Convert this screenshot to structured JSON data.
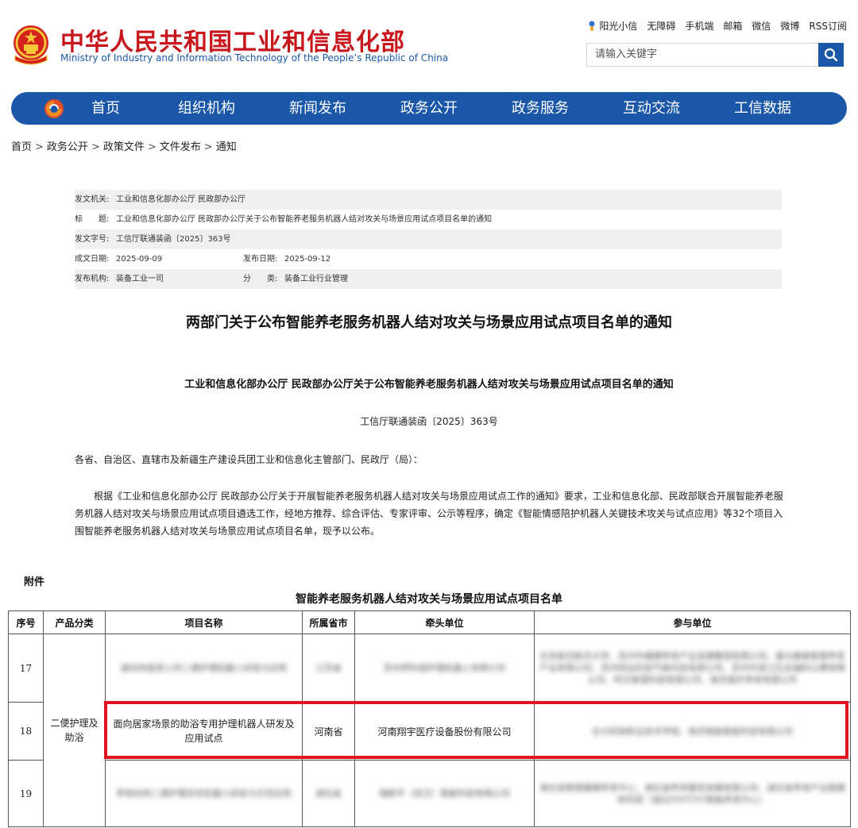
{
  "header": {
    "site_title": "中华人民共和国工业和信息化部",
    "site_subtitle": "Ministry of Industry and Information Technology of the People’s Republic of China",
    "top_links": [
      "阳光小信",
      "无障碍",
      "手机端",
      "邮箱",
      "微信",
      "微博",
      "RSS订阅"
    ],
    "search_placeholder": "请输入关键字"
  },
  "nav": {
    "items": [
      "首页",
      "组织机构",
      "新闻发布",
      "政务公开",
      "政务服务",
      "互动交流",
      "工信数据"
    ]
  },
  "breadcrumb": [
    "首页",
    "政务公开",
    "政策文件",
    "文件发布",
    "通知"
  ],
  "meta": {
    "issuer_label": "发文机关:",
    "issuer_value": "工业和信息化部办公厅 民政部办公厅",
    "title_label": "标　　题:",
    "title_value": "工业和信息化部办公厅 民政部办公厅关于公布智能养老服务机器人结对攻关与场景应用试点项目名单的通知",
    "docno_label": "发文字号:",
    "docno_value": "工信厅联通装函〔2025〕363号",
    "created_label": "成文日期:",
    "created_value": "2025-09-09",
    "published_label": "发布日期:",
    "published_value": "2025-09-12",
    "org_label": "发布机构:",
    "org_value": "装备工业一司",
    "category_label": "分　　类:",
    "category_value": "装备工业行业管理"
  },
  "document": {
    "title": "两部门关于公布智能养老服务机器人结对攻关与场景应用试点项目名单的通知",
    "subtitle": "工业和信息化部办公厅  民政部办公厅关于公布智能养老服务机器人结对攻关与场景应用试点项目名单的通知",
    "number": "工信厅联通装函〔2025〕363号",
    "addressee": "各省、自治区、直辖市及新疆生产建设兵团工业和信息化主管部门、民政厅（局）：",
    "body": "根据《工业和信息化部办公厅  民政部办公厅关于开展智能养老服务机器人结对攻关与场景应用试点工作的通知》要求，工业和信息化部、民政部联合开展智能养老服务机器人结对攻关与场景应用试点项目遴选工作，经地方推荐、综合评估、专家评审、公示等程序，确定《智能情感陪护机器人关键技术攻关与试点应用》等32个项目入围智能养老服务机器人结对攻关与场景应用试点项目名单，现予以公布。",
    "attachment_label": "附件",
    "table_title": "智能养老服务机器人结对攻关与场景应用试点项目名单"
  },
  "table": {
    "headers": [
      "序号",
      "产品分类",
      "项目名称",
      "所属省市",
      "牵头单位",
      "参与单位"
    ],
    "category": "二便护理及助浴",
    "rows": [
      {
        "no": "17",
        "name": "面向失能老人的二便护理机器人研发与应用",
        "province": "江苏省",
        "lead": "苏州伊利诺护理机器人有限公司",
        "partners": "北京航空航天大学、苏州市健康养老产业发展集团有限公司、盛元康泰智慧养老产业有限公司、苏州同业科技气象科技有限公司、苏州市吴江社会福利公寓有限公司、阿贝智慧科技有限公司、南京爱护养老有限公司"
      },
      {
        "no": "18",
        "name": "面向居家场景的助浴专用护理机器人研发及应用试点",
        "province": "河南省",
        "lead": "河南翔宇医疗设备股份有限公司",
        "partners": "长沙民政职业技术学院、南京智能智能科技有限公司"
      },
      {
        "no": "19",
        "name": "养老机构二便护理无忧机器人研发与示范应用",
        "province": "湖北省",
        "lead": "瑞欧平（武汉）智能科技有限公司",
        "partners": "湖北省智慧健康养老中心、湖北省养老服务发展有限公司、湖北省养老产业联盟研究院（湖北PINTNT智能养老中心）"
      }
    ]
  },
  "colors": {
    "brand_red": "#c8161d",
    "brand_blue": "#1a57a8",
    "highlight_red": "#e0141e"
  }
}
